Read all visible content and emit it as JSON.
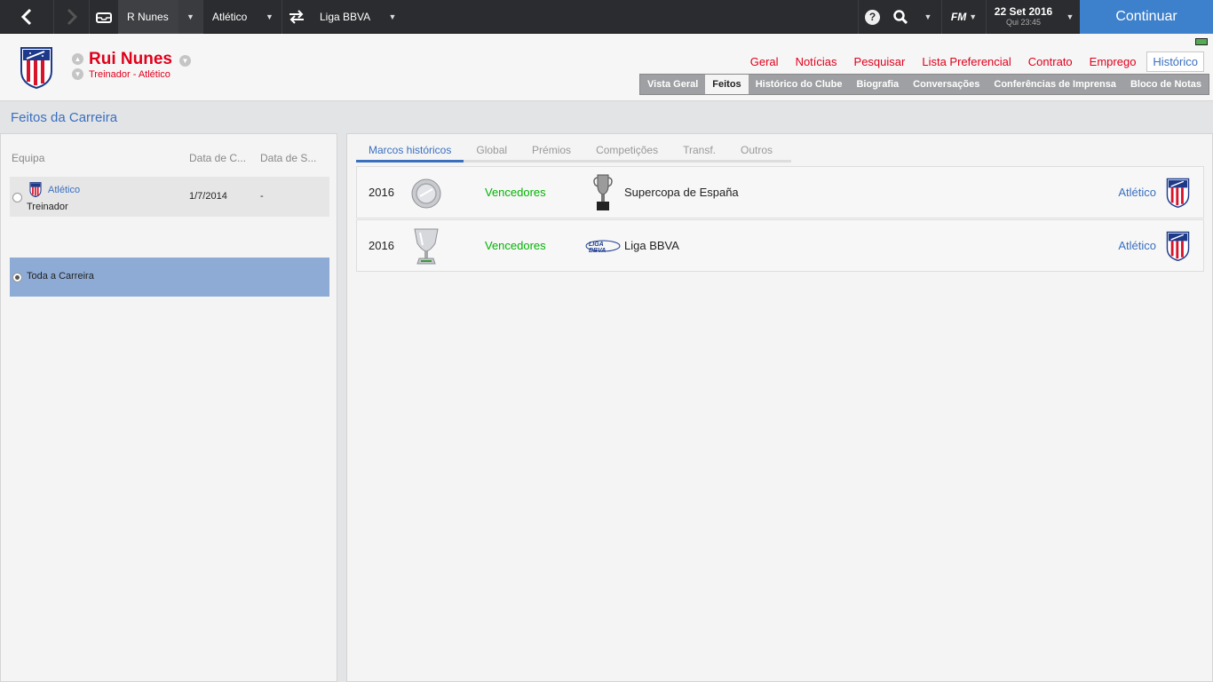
{
  "topbar": {
    "r_nunes": "R Nunes",
    "club": "Atlético",
    "league": "Liga BBVA",
    "help_glyph": "?",
    "fm_logo": "FM",
    "date": "22 Set 2016",
    "time": "Qui 23:45",
    "continue_label": "Continuar"
  },
  "profile": {
    "name": "Rui Nunes",
    "role": "Treinador - Atlético"
  },
  "main_nav": [
    "Geral",
    "Notícias",
    "Pesquisar",
    "Lista Preferencial",
    "Contrato",
    "Emprego",
    "Histórico"
  ],
  "sub_nav": [
    "Vista Geral",
    "Feitos",
    "Histórico do Clube",
    "Biografia",
    "Conversações",
    "Conferências de Imprensa",
    "Bloco de Notas"
  ],
  "section_title": "Feitos da Carreira",
  "career_table": {
    "headers": [
      "Equipa",
      "Data de C...",
      "Data de S..."
    ],
    "rows": [
      {
        "club": "Atlético",
        "role": "Treinador",
        "start": "1/7/2014",
        "end": "-"
      }
    ],
    "all_career_label": "Toda a Carreira"
  },
  "tabs": [
    "Marcos históricos",
    "Global",
    "Prémios",
    "Competições",
    "Transf.",
    "Outros"
  ],
  "achievements": [
    {
      "year": "2016",
      "result": "Vencedores",
      "competition": "Supercopa de España",
      "club": "Atlético"
    },
    {
      "year": "2016",
      "result": "Vencedores",
      "competition": "Liga BBVA",
      "club": "Atlético",
      "logo_text": "LIGA BBVA"
    }
  ],
  "colors": {
    "accent_red": "#e0001b",
    "accent_blue": "#3a6fc0",
    "winners_green": "#00b400",
    "continue_bg": "#3d80cc"
  }
}
